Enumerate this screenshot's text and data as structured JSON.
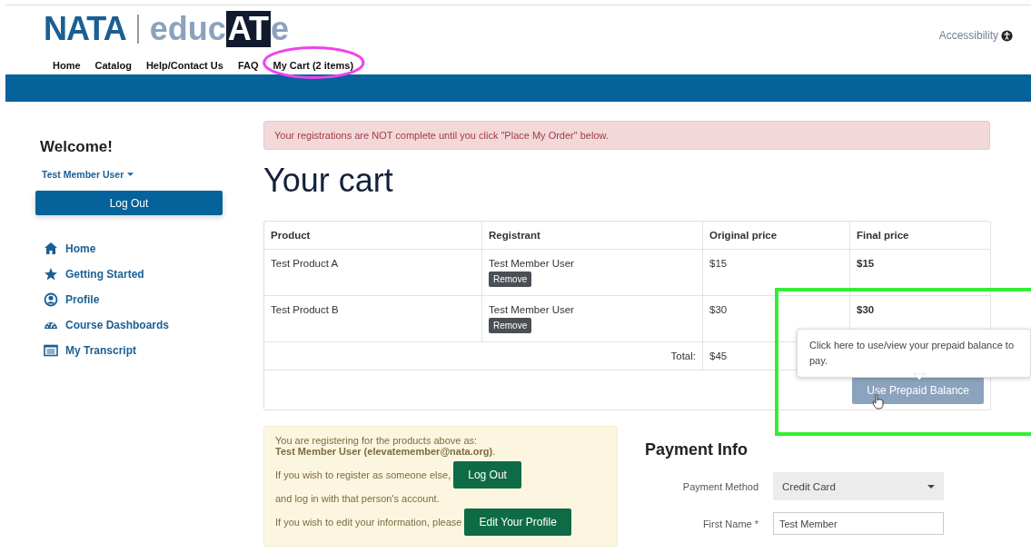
{
  "header": {
    "logo": {
      "primary": "NATA",
      "secondary": "educ",
      "highlight": "AT",
      "suffix": "e"
    },
    "nav": [
      {
        "label": "Home"
      },
      {
        "label": "Catalog"
      },
      {
        "label": "Help/Contact Us"
      },
      {
        "label": "FAQ"
      },
      {
        "label": "My Cart (2 items)"
      }
    ],
    "accessibility": "Accessibility"
  },
  "sidebar": {
    "welcome": "Welcome!",
    "user_menu": "Test Member User",
    "logout": "Log Out",
    "items": [
      {
        "label": "Home"
      },
      {
        "label": "Getting Started"
      },
      {
        "label": "Profile"
      },
      {
        "label": "Course Dashboards"
      },
      {
        "label": "My Transcript"
      }
    ]
  },
  "alert": "Your registrations are NOT complete until you click \"Place My Order\" below.",
  "title": "Your cart",
  "cart": {
    "columns": [
      "Product",
      "Registrant",
      "Original price",
      "Final price"
    ],
    "rows": [
      {
        "product": "Test Product A",
        "registrant": "Test Member User",
        "remove": "Remove",
        "original": "$15",
        "final": "$15"
      },
      {
        "product": "Test Product B",
        "registrant": "Test Member User",
        "remove": "Remove",
        "original": "$30",
        "final": "$30"
      }
    ],
    "total_label": "Total:",
    "total": "$45",
    "prepaid_button": "Use Prepaid Balance",
    "tooltip": "Click here to use/view your prepaid balance to pay."
  },
  "registration": {
    "intro": "You are registering for the products above as:",
    "identity": "**Test Member User (elevatemember@nata.org)**.",
    "line1": "If you wish to register as someone else,",
    "logout": "Log Out",
    "line2": "and log in with that person's account.",
    "line3": "If you wish to edit your information, please",
    "edit": "Edit Your Profile"
  },
  "payment": {
    "title": "Payment Info",
    "fields": [
      {
        "kind": "select",
        "label": "Payment Method",
        "value": "Credit Card"
      },
      {
        "kind": "text",
        "label": "First Name *",
        "value": "Test Member"
      }
    ]
  },
  "annotations": [
    {
      "kind": "ellipse",
      "color": "#ee44ee"
    },
    {
      "kind": "rect",
      "color": "#33ee33"
    }
  ]
}
